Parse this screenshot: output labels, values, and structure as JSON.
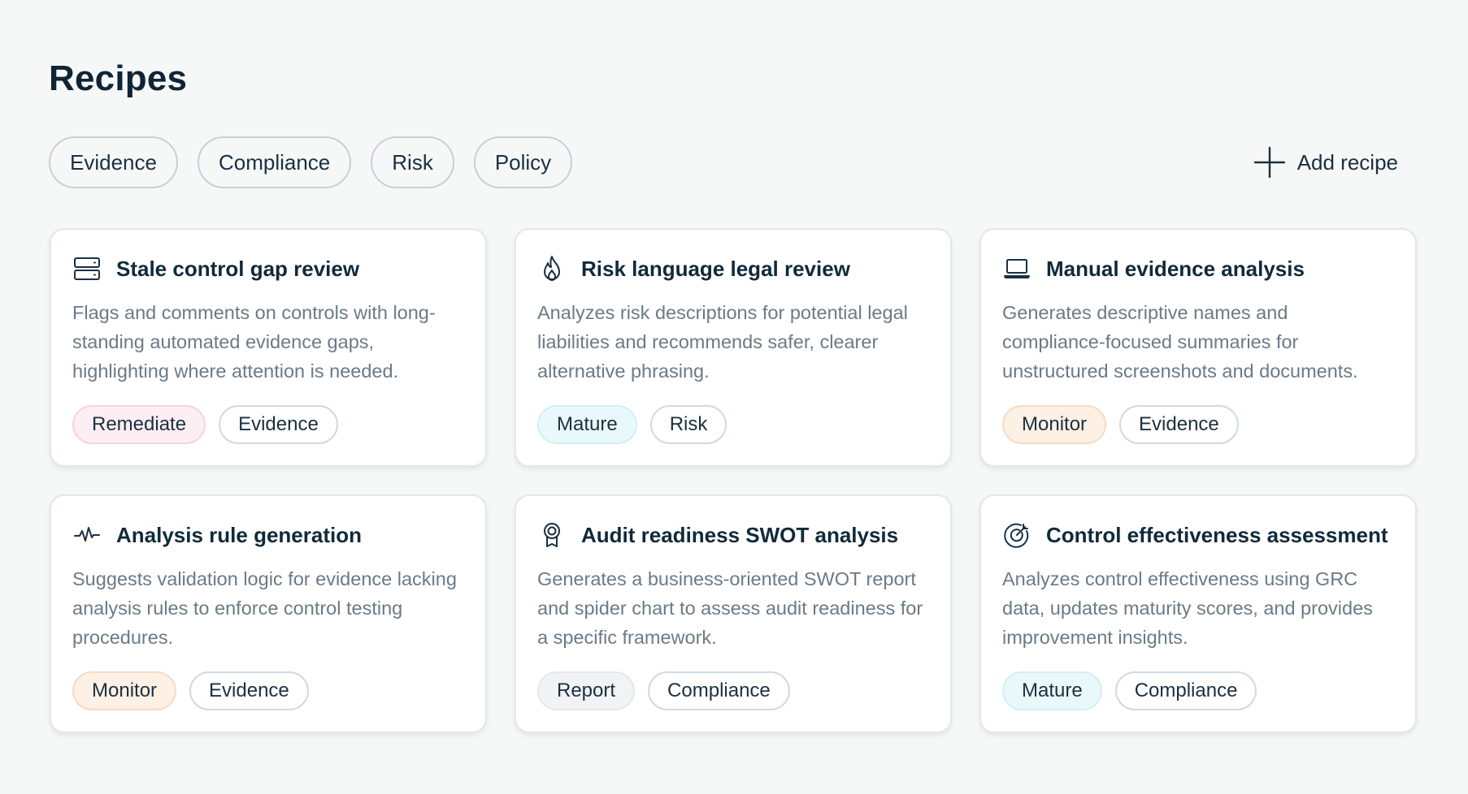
{
  "page": {
    "title": "Recipes"
  },
  "filters": [
    {
      "label": "Evidence"
    },
    {
      "label": "Compliance"
    },
    {
      "label": "Risk"
    },
    {
      "label": "Policy"
    }
  ],
  "actions": {
    "add_recipe_label": "Add recipe",
    "add_icon": "plus-icon"
  },
  "colors": {
    "remediate_bg": "#fdeef3",
    "mature_bg": "#e9f9fb",
    "monitor_bg": "#fdf0e4",
    "report_bg": "#f1f3f4",
    "title_text": "#102a3a",
    "desc_text": "#6b7a86"
  },
  "cards": [
    {
      "icon": "server-icon",
      "title": "Stale control gap review",
      "description": "Flags and comments on controls with long-standing automated evidence gaps, highlighting where attention is needed.",
      "tags": [
        {
          "label": "Remediate",
          "kind": "remediate"
        },
        {
          "label": "Evidence",
          "kind": "outline"
        }
      ]
    },
    {
      "icon": "flame-icon",
      "title": "Risk language legal review",
      "description": "Analyzes risk descriptions for potential legal liabilities and recommends safer, clearer alternative phrasing.",
      "tags": [
        {
          "label": "Mature",
          "kind": "mature"
        },
        {
          "label": "Risk",
          "kind": "outline"
        }
      ]
    },
    {
      "icon": "laptop-icon",
      "title": "Manual evidence analysis",
      "description": "Generates descriptive names and compliance-focused summaries for unstructured screenshots and documents.",
      "tags": [
        {
          "label": "Monitor",
          "kind": "monitor"
        },
        {
          "label": "Evidence",
          "kind": "outline"
        }
      ]
    },
    {
      "icon": "activity-icon",
      "title": "Analysis rule generation",
      "description": "Suggests validation logic for evidence lacking analysis rules to enforce control testing procedures.",
      "tags": [
        {
          "label": "Monitor",
          "kind": "monitor"
        },
        {
          "label": "Evidence",
          "kind": "outline"
        }
      ]
    },
    {
      "icon": "award-icon",
      "title": "Audit readiness SWOT analysis",
      "description": "Generates a business-oriented SWOT report and spider chart to assess audit readiness for a specific framework.",
      "tags": [
        {
          "label": "Report",
          "kind": "report"
        },
        {
          "label": "Compliance",
          "kind": "outline"
        }
      ]
    },
    {
      "icon": "target-icon",
      "title": "Control effectiveness assessment",
      "description": "Analyzes control effectiveness using GRC data, updates maturity scores, and provides improvement insights.",
      "tags": [
        {
          "label": "Mature",
          "kind": "mature"
        },
        {
          "label": "Compliance",
          "kind": "outline"
        }
      ]
    }
  ]
}
